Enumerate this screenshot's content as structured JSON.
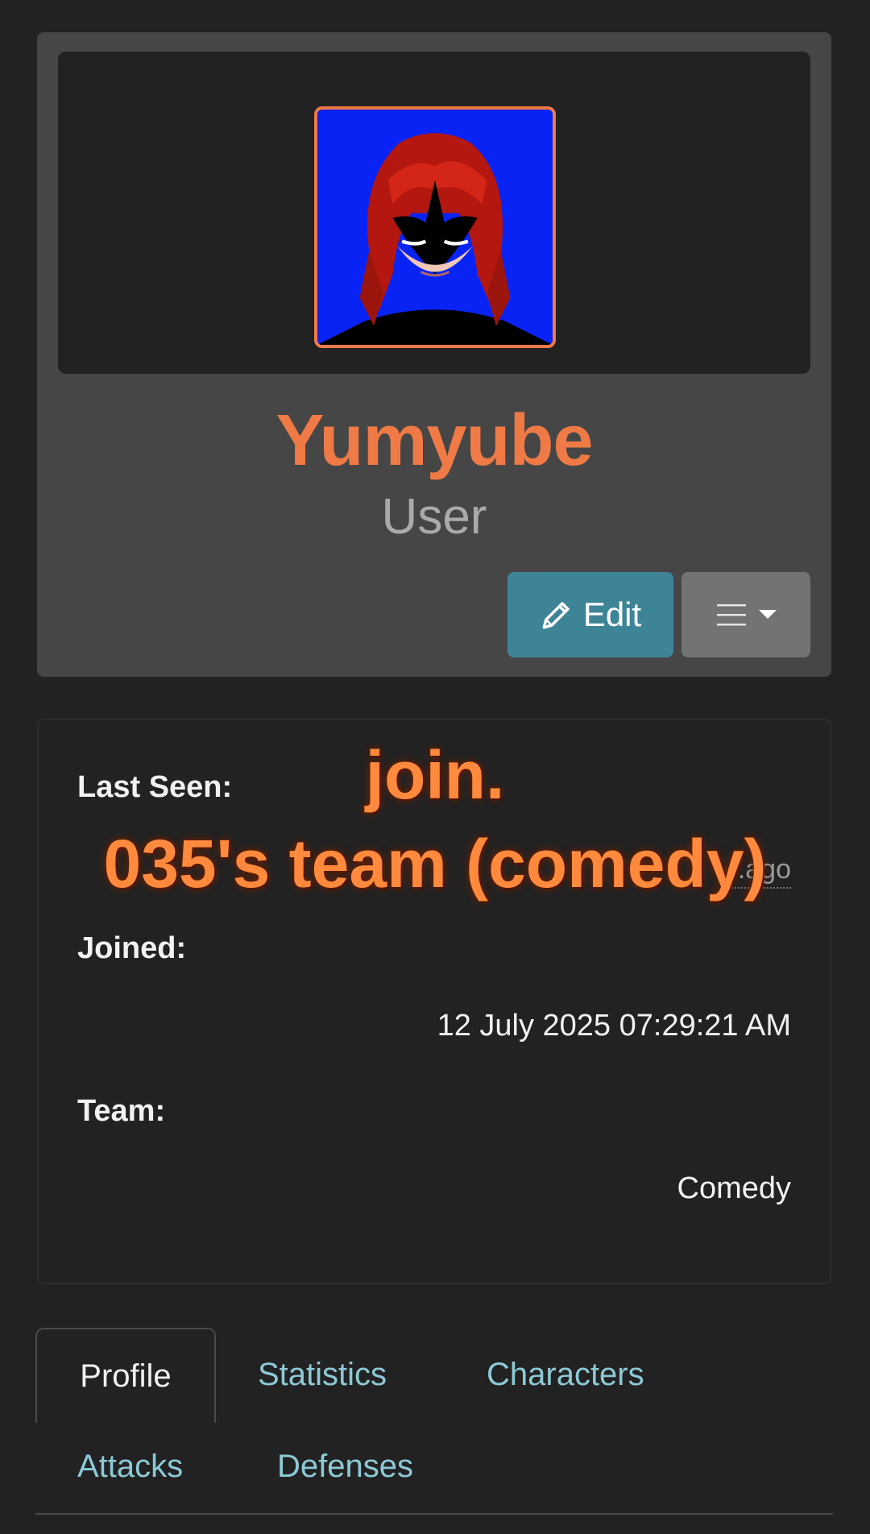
{
  "profile": {
    "username": "Yumyube",
    "role": "User",
    "avatar_icon": "avatar-image",
    "edit_label": "Edit",
    "edit_icon": "pencil-icon",
    "menu_icon": "hamburger-icon",
    "dropdown_icon": "caret-down-icon"
  },
  "info": {
    "last_seen_label": "Last Seen:",
    "last_seen_value": "...ago",
    "joined_label": "Joined:",
    "joined_value": "12 July 2025 07:29:21 AM",
    "team_label": "Team:",
    "team_value": "Comedy"
  },
  "overlay": {
    "line1": "join.",
    "line2": "035's team (comedy)"
  },
  "tabs": [
    {
      "label": "Profile",
      "active": true
    },
    {
      "label": "Statistics",
      "active": false
    },
    {
      "label": "Characters",
      "active": false
    },
    {
      "label": "Attacks",
      "active": false
    },
    {
      "label": "Defenses",
      "active": false
    }
  ],
  "colors": {
    "accent": "#f07a45",
    "edit_button": "#3e8497",
    "tab_link": "#8dc9d6",
    "background": "#222222",
    "card": "#464646"
  }
}
